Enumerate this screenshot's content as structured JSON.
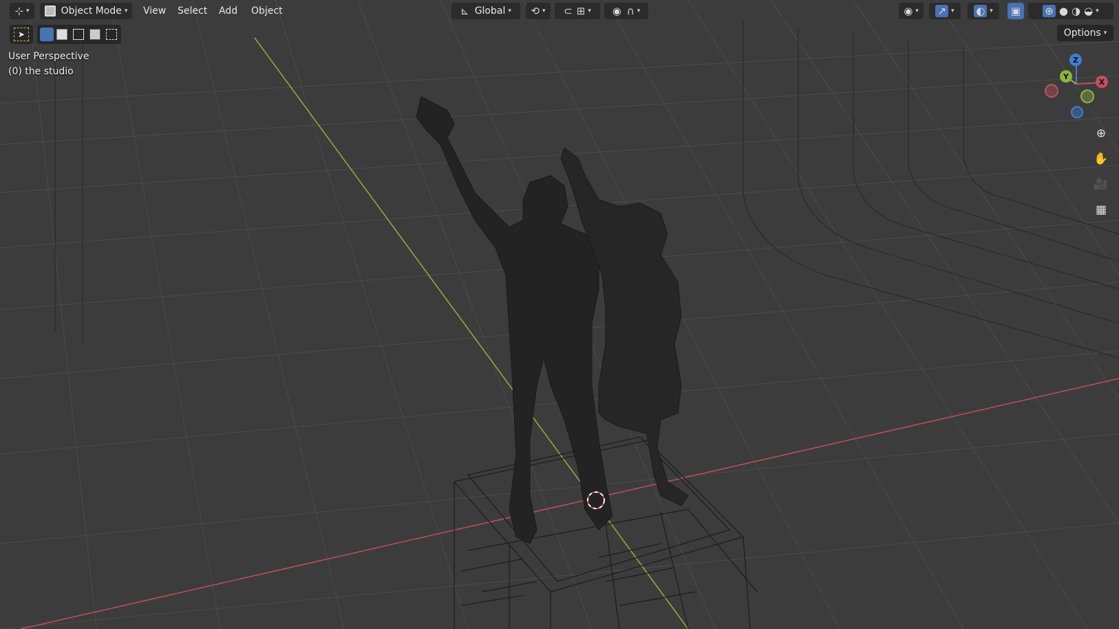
{
  "header": {
    "editor_icon": "editor-type-icon",
    "mode": {
      "icon": "object-mode-icon",
      "label": "Object Mode"
    },
    "menus": [
      "View",
      "Select",
      "Add",
      "Object"
    ],
    "transform_orientation": {
      "icon": "orientation-icon",
      "label": "Global"
    },
    "pivot_icon": "pivot-icon",
    "snap_icon": "snap-icon",
    "snap_target_icon": "snap-increment-icon",
    "proportional_icon": "proportional-edit-icon",
    "falloff_icon": "falloff-icon",
    "visibility_icon": "eye-icon",
    "gizmo_icon": "gizmo-icon",
    "overlay_icon": "overlay-icon",
    "xray_icon": "xray-icon",
    "shading": {
      "wireframe": "wireframe-shading-icon",
      "solid": "solid-shading-icon",
      "material": "material-shading-icon",
      "rendered": "rendered-shading-icon"
    }
  },
  "toolbar2": {
    "select_tool": "select-box-icon",
    "modes": [
      "mode-new-icon",
      "mode-extend-icon",
      "mode-subtract-icon",
      "mode-invert-icon",
      "mode-intersect-icon"
    ]
  },
  "options_label": "Options",
  "viewport": {
    "perspective": "User Perspective",
    "collection": "(0) the studio"
  },
  "gizmo": {
    "x": "X",
    "y": "Y",
    "z": "Z"
  },
  "nav": [
    "zoom-icon",
    "pan-hand-icon",
    "camera-icon",
    "grid-view-icon"
  ],
  "colors": {
    "background": "#3c3c3c",
    "grid": "#4a4a4a",
    "x_axis": "#c1505a",
    "y_axis": "#8cb53a",
    "z_axis": "#3f7fd6",
    "active": "#4772b3"
  }
}
